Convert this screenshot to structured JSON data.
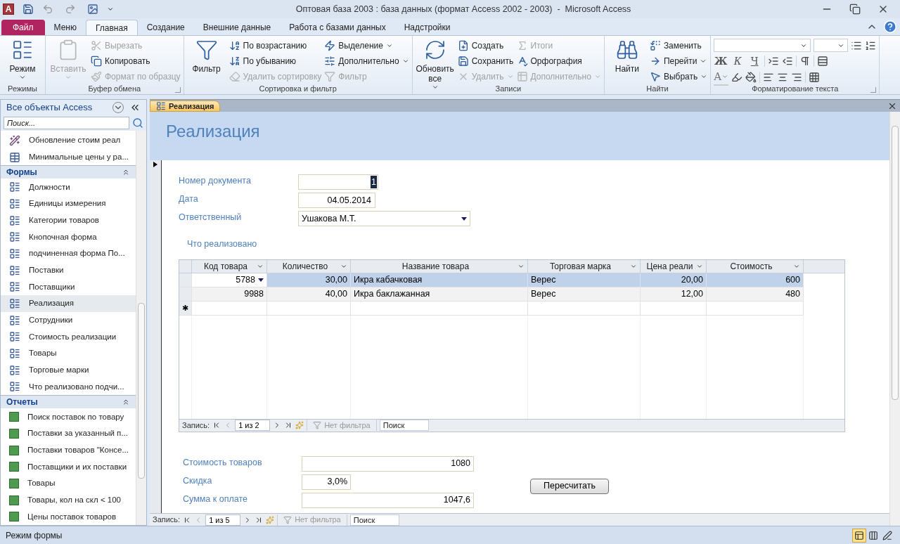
{
  "title_bar": {
    "logo": "A",
    "title": "Оптовая база 2003 : база данных (формат Access 2002 - 2003)  -  Microsoft Access"
  },
  "ribbon_tabs": [
    {
      "label": "Файл",
      "kind": "file",
      "selected": false
    },
    {
      "label": "Меню",
      "kind": "tab",
      "selected": false
    },
    {
      "label": "Главная",
      "kind": "tab",
      "selected": true
    },
    {
      "label": "Создание",
      "kind": "tab",
      "selected": false
    },
    {
      "label": "Внешние данные",
      "kind": "tab",
      "selected": false
    },
    {
      "label": "Работа с базами данных",
      "kind": "tab",
      "selected": false
    },
    {
      "label": "Надстройки",
      "kind": "tab",
      "selected": false
    }
  ],
  "ribbon_groups": [
    {
      "label": "Режимы",
      "launcher": false,
      "columns": [
        [
          {
            "label": "Режим",
            "kind": "large",
            "disabled": false,
            "dropdown": true
          }
        ]
      ]
    },
    {
      "label": "Буфер обмена",
      "launcher": true,
      "columns": [
        [
          {
            "label": "Вставить",
            "kind": "large",
            "disabled": true,
            "dropdown": true
          }
        ],
        [
          {
            "label": "Вырезать",
            "kind": "small",
            "disabled": true,
            "dropdown": false
          },
          {
            "label": "Копировать",
            "kind": "small",
            "disabled": false,
            "dropdown": false
          },
          {
            "label": "Формат по образцу",
            "kind": "small",
            "disabled": true,
            "dropdown": false
          }
        ]
      ]
    },
    {
      "label": "Сортировка и фильтр",
      "launcher": false,
      "columns": [
        [
          {
            "label": "Фильтр",
            "kind": "large",
            "disabled": false,
            "dropdown": false
          }
        ],
        [
          {
            "label": "По возрастанию",
            "kind": "small",
            "disabled": false,
            "dropdown": false
          },
          {
            "label": "По убыванию",
            "kind": "small",
            "disabled": false,
            "dropdown": false
          },
          {
            "label": "Удалить сортировку",
            "kind": "small",
            "disabled": true,
            "dropdown": false
          }
        ],
        [
          {
            "label": "Выделение",
            "kind": "small",
            "disabled": false,
            "dropdown": true
          },
          {
            "label": "Дополнительно",
            "kind": "small",
            "disabled": false,
            "dropdown": true
          },
          {
            "label": "Фильтр",
            "kind": "small",
            "disabled": true,
            "dropdown": false
          }
        ]
      ]
    },
    {
      "label": "Записи",
      "launcher": false,
      "columns": [
        [
          {
            "label": "Обновить все",
            "kind": "large",
            "disabled": false,
            "dropdown": true
          }
        ],
        [
          {
            "label": "Создать",
            "kind": "small",
            "disabled": false,
            "dropdown": false
          },
          {
            "label": "Сохранить",
            "kind": "small",
            "disabled": false,
            "dropdown": false
          },
          {
            "label": "Удалить",
            "kind": "small",
            "disabled": true,
            "dropdown": true
          }
        ],
        [
          {
            "label": "Итоги",
            "kind": "small",
            "disabled": true,
            "dropdown": false
          },
          {
            "label": "Орфография",
            "kind": "small",
            "disabled": false,
            "dropdown": false
          },
          {
            "label": "Дополнительно",
            "kind": "small",
            "disabled": true,
            "dropdown": true
          }
        ]
      ]
    },
    {
      "label": "Найти",
      "launcher": false,
      "columns": [
        [
          {
            "label": "Найти",
            "kind": "large",
            "disabled": false,
            "dropdown": false
          }
        ],
        [
          {
            "label": "Заменить",
            "kind": "small",
            "disabled": false,
            "dropdown": false
          },
          {
            "label": "Перейти",
            "kind": "small",
            "disabled": false,
            "dropdown": true
          },
          {
            "label": "Выбрать",
            "kind": "small",
            "disabled": false,
            "dropdown": true
          }
        ]
      ]
    }
  ],
  "text_format": {
    "label": "Форматирование текста",
    "format_buttons": [
      {
        "label": "Ж",
        "kind": "bold"
      },
      {
        "label": "К",
        "kind": "italic"
      },
      {
        "label": "Ч",
        "kind": "underline"
      }
    ],
    "font_color_label": "A"
  },
  "nav_pane": {
    "title": "Все объекты Access",
    "search_placeholder": "Поиск...",
    "items": [
      {
        "label": "Обновление стоим реал",
        "kind": "macro",
        "selected": false
      },
      {
        "label": "Минимальные цены у ра...",
        "kind": "query",
        "selected": false
      }
    ],
    "sections": [
      {
        "title": "Формы",
        "items": [
          {
            "label": "Должности",
            "kind": "form",
            "selected": false
          },
          {
            "label": "Единицы измерения",
            "kind": "form",
            "selected": false
          },
          {
            "label": "Категории товаров",
            "kind": "form",
            "selected": false
          },
          {
            "label": "Кнопочная форма",
            "kind": "form",
            "selected": false
          },
          {
            "label": "подчиненная форма По...",
            "kind": "form",
            "selected": false
          },
          {
            "label": "Поставки",
            "kind": "form",
            "selected": false
          },
          {
            "label": "Поставщики",
            "kind": "form",
            "selected": false
          },
          {
            "label": "Реализация",
            "kind": "form",
            "selected": true
          },
          {
            "label": "Сотрудники",
            "kind": "form",
            "selected": false
          },
          {
            "label": "Стоимость реализации",
            "kind": "form",
            "selected": false
          },
          {
            "label": "Товары",
            "kind": "form",
            "selected": false
          },
          {
            "label": "Торговые марки",
            "kind": "form",
            "selected": false
          },
          {
            "label": "Что реализовано подчи...",
            "kind": "form",
            "selected": false
          }
        ]
      },
      {
        "title": "Отчеты",
        "items": [
          {
            "label": "Поиск поставок по товару",
            "kind": "report",
            "selected": false
          },
          {
            "label": "Поставки за указанный п...",
            "kind": "report",
            "selected": false
          },
          {
            "label": "Поставки товаров \"Консе...",
            "kind": "report",
            "selected": false
          },
          {
            "label": "Поставщики и их поставки",
            "kind": "report",
            "selected": false
          },
          {
            "label": "Товары",
            "kind": "report",
            "selected": false
          },
          {
            "label": "Товары, кол на скл < 100",
            "kind": "report",
            "selected": false
          },
          {
            "label": "Цены поставок товаров",
            "kind": "report",
            "selected": false
          }
        ]
      }
    ]
  },
  "document_tab": {
    "label": "Реализация"
  },
  "form": {
    "title": "Реализация",
    "fields": [
      {
        "label": "Номер документа",
        "value": "1",
        "kind": "text",
        "value_selected": true
      },
      {
        "label": "Дата",
        "value": "04.05.2014",
        "kind": "text",
        "value_selected": false
      },
      {
        "label": "Ответственный",
        "value": "Ушакова М.Т.",
        "kind": "combo",
        "value_selected": false
      }
    ],
    "subform_label": "Что реализовано",
    "subform": {
      "columns": [
        "Код товара",
        "Количество",
        "Название товара",
        "Торговая марка",
        "Цена реали",
        "Стоимость"
      ],
      "rows": [
        {
          "selected": true,
          "cells": [
            "5788",
            "30,00",
            "Икра кабачковая",
            "Верес",
            "20,00",
            "600"
          ]
        },
        {
          "selected": false,
          "cells": [
            "9988",
            "40,00",
            "Икра баклажанная",
            "Верес",
            "12,00",
            "480"
          ]
        }
      ],
      "new_row_marker": "✱",
      "navigator": {
        "label": "Запись:",
        "position": "1 из 2",
        "filter": "Нет фильтра",
        "search": "Поиск"
      }
    },
    "totals": [
      {
        "label": "Стоимость товаров",
        "value": "1080",
        "kind": "wide"
      },
      {
        "label": "Скидка",
        "value": "3,0%",
        "kind": "narrow"
      },
      {
        "label": "Сумма к оплате",
        "value": "1047,6",
        "kind": "wide"
      }
    ],
    "button": "Пересчитать"
  },
  "navigator": {
    "label": "Запись:",
    "position": "1 из 5",
    "filter": "Нет фильтра",
    "search": "Поиск"
  },
  "status_bar": {
    "text": "Режим формы",
    "views": [
      {
        "selected": true
      },
      {
        "selected": false
      },
      {
        "selected": false
      }
    ]
  }
}
